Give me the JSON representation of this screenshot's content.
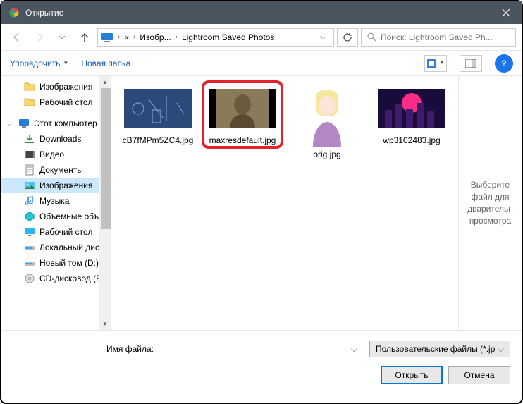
{
  "title": "Открытие",
  "breadcrumb": {
    "c1": "Изобр...",
    "c2": "Lightroom Saved Photos",
    "prefix": "«"
  },
  "search": {
    "placeholder": "Поиск: Lightroom Saved Ph..."
  },
  "toolbar": {
    "organize": "Упорядочить",
    "newfolder": "Новая папка"
  },
  "sidebar": {
    "items": [
      {
        "label": "Изображения",
        "icon": "folder"
      },
      {
        "label": "Рабочий стол",
        "icon": "folder"
      },
      {
        "label": "Этот компьютер",
        "icon": "pc",
        "level": 1,
        "expanded": true
      },
      {
        "label": "Downloads",
        "icon": "downloads"
      },
      {
        "label": "Видео",
        "icon": "video"
      },
      {
        "label": "Документы",
        "icon": "docs"
      },
      {
        "label": "Изображения",
        "icon": "images",
        "selected": true
      },
      {
        "label": "Музыка",
        "icon": "music"
      },
      {
        "label": "Объемные объ",
        "icon": "3d"
      },
      {
        "label": "Рабочий стол",
        "icon": "desktop"
      },
      {
        "label": "Локальный дис",
        "icon": "disk"
      },
      {
        "label": "Новый том (D:)",
        "icon": "disk"
      },
      {
        "label": "CD-дисковод (F",
        "icon": "cd"
      }
    ]
  },
  "files": [
    {
      "name": "cB7fMPm5ZC4.jpg"
    },
    {
      "name": "maxresdefault.jpg",
      "highlighted": true
    },
    {
      "name": "orig.jpg"
    },
    {
      "name": "wp3102483.jpg"
    }
  ],
  "preview": "Выберите файл для дварительн просмотра",
  "footer": {
    "filename_label_pre": "И",
    "filename_label_u": "м",
    "filename_label_post": "я файла:",
    "filetype": "Пользовательские файлы (*.jp",
    "open": "Открыть",
    "open_u": "О",
    "open_rest": "ткрыть",
    "cancel": "Отмена"
  }
}
